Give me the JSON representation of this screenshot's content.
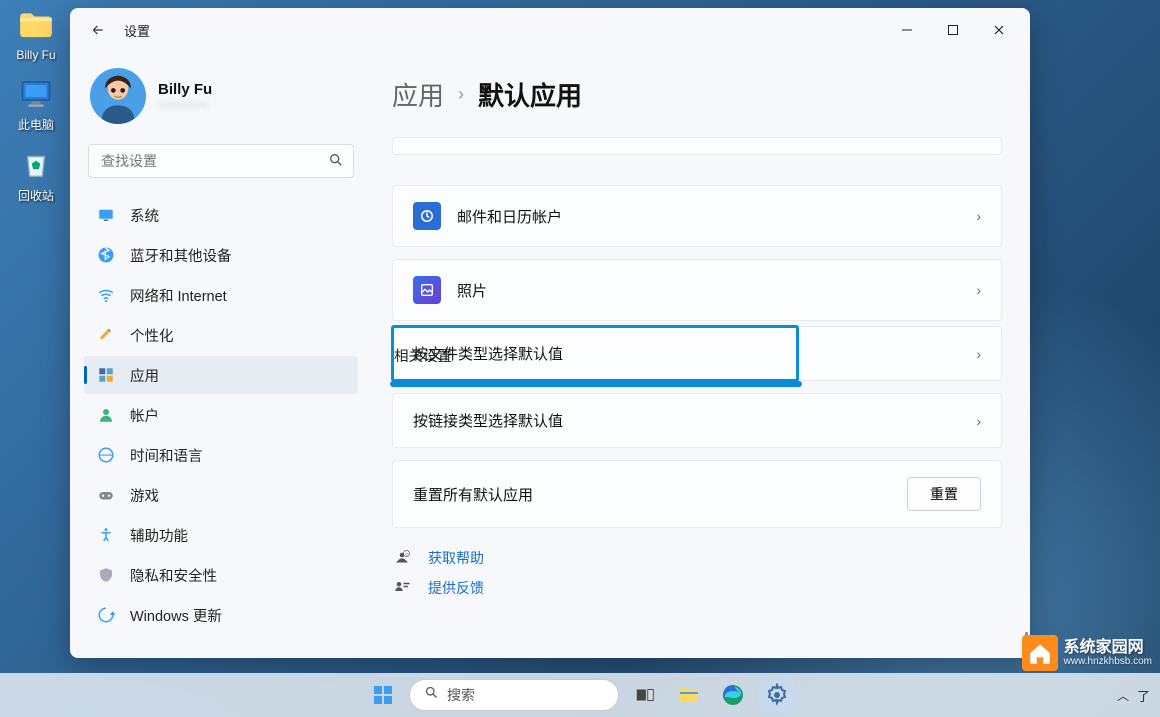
{
  "desktop": {
    "icons": [
      {
        "label": "Billy Fu"
      },
      {
        "label": "此电脑"
      },
      {
        "label": "回收站"
      }
    ]
  },
  "window": {
    "title": "设置",
    "profile": {
      "name": "Billy Fu",
      "sub": "••••••••••••"
    },
    "search": {
      "placeholder": "查找设置"
    },
    "nav": {
      "system": "系统",
      "bluetooth": "蓝牙和其他设备",
      "network": "网络和 Internet",
      "personalization": "个性化",
      "apps": "应用",
      "accounts": "帐户",
      "time": "时间和语言",
      "gaming": "游戏",
      "accessibility": "辅助功能",
      "privacy": "隐私和安全性",
      "update": "Windows 更新"
    },
    "breadcrumb": {
      "l1": "应用",
      "l2": "默认应用"
    },
    "cards": {
      "mail": "邮件和日历帐户",
      "photos": "照片"
    },
    "related_settings_label": "相关设置",
    "related": {
      "by_file_type": "按文件类型选择默认值",
      "by_link_type": "按链接类型选择默认值",
      "reset_label": "重置所有默认应用",
      "reset_button": "重置"
    },
    "help": {
      "get_help": "获取帮助",
      "feedback": "提供反馈"
    }
  },
  "taskbar": {
    "search": "搜索",
    "tray": {
      "chevron": "^",
      "clock": "了"
    }
  },
  "watermark": {
    "name": "系统家园网",
    "url": "www.hnzkhbsb.com"
  }
}
